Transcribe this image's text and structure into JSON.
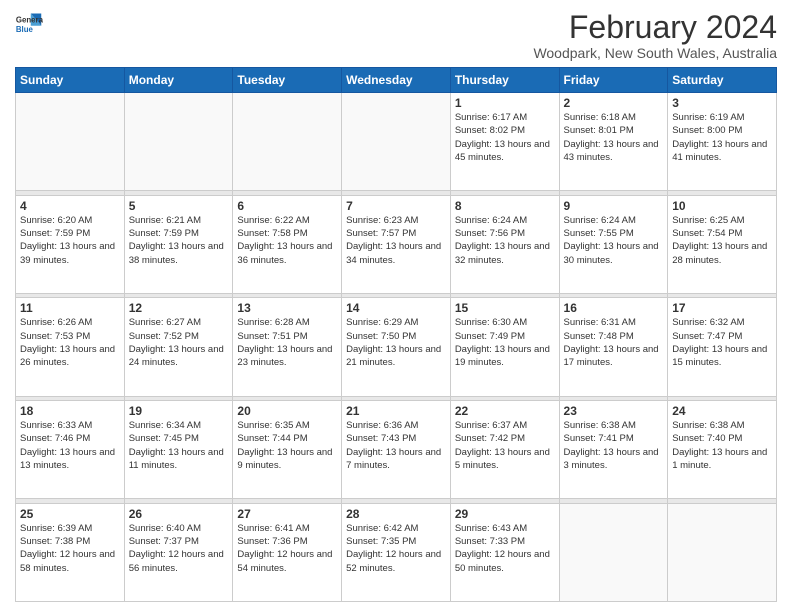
{
  "logo": {
    "line1": "General",
    "line2": "Blue",
    "icon_color": "#1a6bb5"
  },
  "title": "February 2024",
  "location": "Woodpark, New South Wales, Australia",
  "days_of_week": [
    "Sunday",
    "Monday",
    "Tuesday",
    "Wednesday",
    "Thursday",
    "Friday",
    "Saturday"
  ],
  "weeks": [
    {
      "days": [
        {
          "num": "",
          "data": ""
        },
        {
          "num": "",
          "data": ""
        },
        {
          "num": "",
          "data": ""
        },
        {
          "num": "",
          "data": ""
        },
        {
          "num": "1",
          "data": "Sunrise: 6:17 AM\nSunset: 8:02 PM\nDaylight: 13 hours\nand 45 minutes."
        },
        {
          "num": "2",
          "data": "Sunrise: 6:18 AM\nSunset: 8:01 PM\nDaylight: 13 hours\nand 43 minutes."
        },
        {
          "num": "3",
          "data": "Sunrise: 6:19 AM\nSunset: 8:00 PM\nDaylight: 13 hours\nand 41 minutes."
        }
      ]
    },
    {
      "days": [
        {
          "num": "4",
          "data": "Sunrise: 6:20 AM\nSunset: 7:59 PM\nDaylight: 13 hours\nand 39 minutes."
        },
        {
          "num": "5",
          "data": "Sunrise: 6:21 AM\nSunset: 7:59 PM\nDaylight: 13 hours\nand 38 minutes."
        },
        {
          "num": "6",
          "data": "Sunrise: 6:22 AM\nSunset: 7:58 PM\nDaylight: 13 hours\nand 36 minutes."
        },
        {
          "num": "7",
          "data": "Sunrise: 6:23 AM\nSunset: 7:57 PM\nDaylight: 13 hours\nand 34 minutes."
        },
        {
          "num": "8",
          "data": "Sunrise: 6:24 AM\nSunset: 7:56 PM\nDaylight: 13 hours\nand 32 minutes."
        },
        {
          "num": "9",
          "data": "Sunrise: 6:24 AM\nSunset: 7:55 PM\nDaylight: 13 hours\nand 30 minutes."
        },
        {
          "num": "10",
          "data": "Sunrise: 6:25 AM\nSunset: 7:54 PM\nDaylight: 13 hours\nand 28 minutes."
        }
      ]
    },
    {
      "days": [
        {
          "num": "11",
          "data": "Sunrise: 6:26 AM\nSunset: 7:53 PM\nDaylight: 13 hours\nand 26 minutes."
        },
        {
          "num": "12",
          "data": "Sunrise: 6:27 AM\nSunset: 7:52 PM\nDaylight: 13 hours\nand 24 minutes."
        },
        {
          "num": "13",
          "data": "Sunrise: 6:28 AM\nSunset: 7:51 PM\nDaylight: 13 hours\nand 23 minutes."
        },
        {
          "num": "14",
          "data": "Sunrise: 6:29 AM\nSunset: 7:50 PM\nDaylight: 13 hours\nand 21 minutes."
        },
        {
          "num": "15",
          "data": "Sunrise: 6:30 AM\nSunset: 7:49 PM\nDaylight: 13 hours\nand 19 minutes."
        },
        {
          "num": "16",
          "data": "Sunrise: 6:31 AM\nSunset: 7:48 PM\nDaylight: 13 hours\nand 17 minutes."
        },
        {
          "num": "17",
          "data": "Sunrise: 6:32 AM\nSunset: 7:47 PM\nDaylight: 13 hours\nand 15 minutes."
        }
      ]
    },
    {
      "days": [
        {
          "num": "18",
          "data": "Sunrise: 6:33 AM\nSunset: 7:46 PM\nDaylight: 13 hours\nand 13 minutes."
        },
        {
          "num": "19",
          "data": "Sunrise: 6:34 AM\nSunset: 7:45 PM\nDaylight: 13 hours\nand 11 minutes."
        },
        {
          "num": "20",
          "data": "Sunrise: 6:35 AM\nSunset: 7:44 PM\nDaylight: 13 hours\nand 9 minutes."
        },
        {
          "num": "21",
          "data": "Sunrise: 6:36 AM\nSunset: 7:43 PM\nDaylight: 13 hours\nand 7 minutes."
        },
        {
          "num": "22",
          "data": "Sunrise: 6:37 AM\nSunset: 7:42 PM\nDaylight: 13 hours\nand 5 minutes."
        },
        {
          "num": "23",
          "data": "Sunrise: 6:38 AM\nSunset: 7:41 PM\nDaylight: 13 hours\nand 3 minutes."
        },
        {
          "num": "24",
          "data": "Sunrise: 6:38 AM\nSunset: 7:40 PM\nDaylight: 13 hours\nand 1 minute."
        }
      ]
    },
    {
      "days": [
        {
          "num": "25",
          "data": "Sunrise: 6:39 AM\nSunset: 7:38 PM\nDaylight: 12 hours\nand 58 minutes."
        },
        {
          "num": "26",
          "data": "Sunrise: 6:40 AM\nSunset: 7:37 PM\nDaylight: 12 hours\nand 56 minutes."
        },
        {
          "num": "27",
          "data": "Sunrise: 6:41 AM\nSunset: 7:36 PM\nDaylight: 12 hours\nand 54 minutes."
        },
        {
          "num": "28",
          "data": "Sunrise: 6:42 AM\nSunset: 7:35 PM\nDaylight: 12 hours\nand 52 minutes."
        },
        {
          "num": "29",
          "data": "Sunrise: 6:43 AM\nSunset: 7:33 PM\nDaylight: 12 hours\nand 50 minutes."
        },
        {
          "num": "",
          "data": ""
        },
        {
          "num": "",
          "data": ""
        }
      ]
    }
  ]
}
